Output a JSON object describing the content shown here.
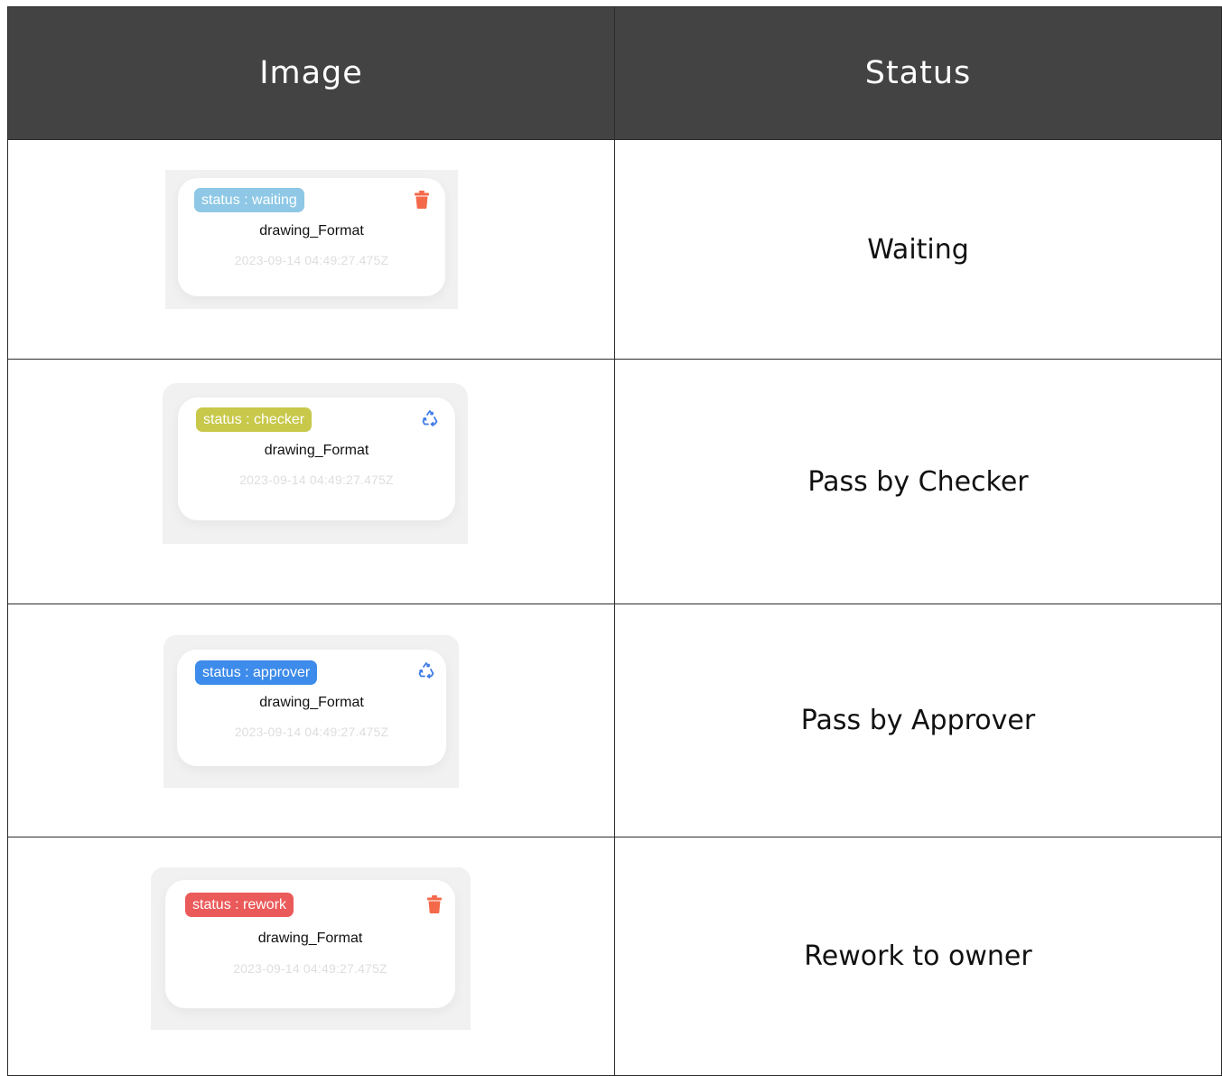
{
  "table": {
    "headers": {
      "image": "Image",
      "status": "Status"
    },
    "rows": [
      {
        "status_text": "Waiting",
        "card": {
          "chip_label": "status : waiting",
          "chip_color": "#8ec8e6",
          "title": "drawing_Format",
          "timestamp": "2023-09-14 04:49:27.475Z",
          "action_icon": "trash-icon",
          "action_color": "#f4694a"
        }
      },
      {
        "status_text": "Pass by Checker",
        "card": {
          "chip_label": "status : checker",
          "chip_color": "#c8c84a",
          "title": "drawing_Format",
          "timestamp": "2023-09-14 04:49:27.475Z",
          "action_icon": "recycle-icon",
          "action_color": "#3d7be6"
        }
      },
      {
        "status_text": "Pass by Approver",
        "card": {
          "chip_label": "status : approver",
          "chip_color": "#3d8bea",
          "title": "drawing_Format",
          "timestamp": "2023-09-14 04:49:27.475Z",
          "action_icon": "recycle-icon",
          "action_color": "#3d7be6"
        }
      },
      {
        "status_text": "Rework to owner",
        "card": {
          "chip_label": "status : rework",
          "chip_color": "#eb5a5a",
          "title": "drawing_Format",
          "timestamp": "2023-09-14 04:49:27.475Z",
          "action_icon": "trash-icon",
          "action_color": "#f4694a"
        }
      }
    ]
  }
}
